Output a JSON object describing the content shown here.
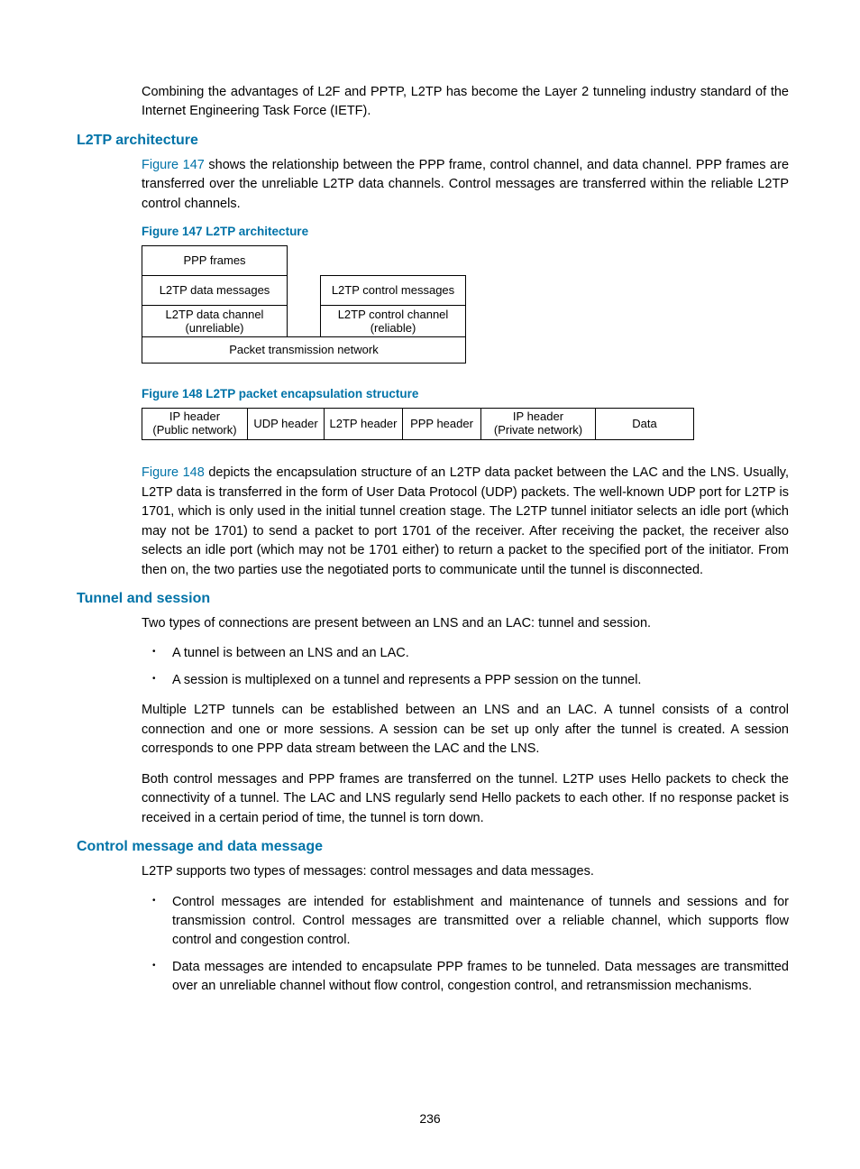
{
  "intro_paragraph": "Combining the advantages of L2F and PPTP, L2TP has become the Layer 2 tunneling industry standard of the Internet Engineering Task Force (IETF).",
  "sec_arch": {
    "heading": "L2TP architecture",
    "p1_link": "Figure 147",
    "p1_rest": " shows the relationship between the PPP frame, control channel, and data channel. PPP frames are transferred over the unreliable L2TP data channels. Control messages are transferred within the reliable L2TP control channels.",
    "fig147_caption": "Figure 147 L2TP architecture",
    "fig147": {
      "ppp": "PPP frames",
      "data_msg": "L2TP data messages",
      "ctrl_msg": "L2TP control messages",
      "data_ch_l1": "L2TP data channel",
      "data_ch_l2": "(unreliable)",
      "ctrl_ch_l1": "L2TP control channel",
      "ctrl_ch_l2": "(reliable)",
      "bottom": "Packet transmission network"
    },
    "fig148_caption": "Figure 148 L2TP packet encapsulation structure",
    "fig148": {
      "c1_l1": "IP header",
      "c1_l2": "(Public network)",
      "c2": "UDP header",
      "c3": "L2TP header",
      "c4": "PPP header",
      "c5_l1": "IP header",
      "c5_l2": "(Private network)",
      "c6": "Data"
    },
    "p2_link": "Figure 148",
    "p2_rest": " depicts the encapsulation structure of an L2TP data packet between the LAC and the LNS. Usually, L2TP data is transferred in the form of User Data Protocol (UDP) packets. The well-known UDP port for L2TP is 1701, which is only used in the initial tunnel creation stage. The L2TP tunnel initiator selects an idle port (which may not be 1701) to send a packet to port 1701 of the receiver. After receiving the packet, the receiver also selects an idle port (which may not be 1701 either) to return a packet to the specified port of the initiator. From then on, the two parties use the negotiated ports to communicate until the tunnel is disconnected."
  },
  "sec_tunnel": {
    "heading": "Tunnel and session",
    "p1": "Two types of connections are present between an LNS and an LAC: tunnel and session.",
    "b1": "A tunnel is between an LNS and an LAC.",
    "b2": "A session is multiplexed on a tunnel and represents a PPP session on the tunnel.",
    "p2": "Multiple L2TP tunnels can be established between an LNS and an LAC. A tunnel consists of a control connection and one or more sessions. A session can be set up only after the tunnel is created. A session corresponds to one PPP data stream between the LAC and the LNS.",
    "p3": "Both control messages and PPP frames are transferred on the tunnel. L2TP uses Hello packets to check the connectivity of a tunnel. The LAC and LNS regularly send Hello packets to each other. If no response packet is received in a certain period of time, the tunnel is torn down."
  },
  "sec_msg": {
    "heading": "Control message and data message",
    "p1": "L2TP supports two types of messages: control messages and data messages.",
    "b1": "Control messages are intended for establishment and maintenance of tunnels and sessions and for transmission control. Control messages are transmitted over a reliable channel, which supports flow control and congestion control.",
    "b2": "Data messages are intended to encapsulate PPP frames to be tunneled. Data messages are transmitted over an unreliable channel without flow control, congestion control, and retransmission mechanisms."
  },
  "page_number": "236"
}
